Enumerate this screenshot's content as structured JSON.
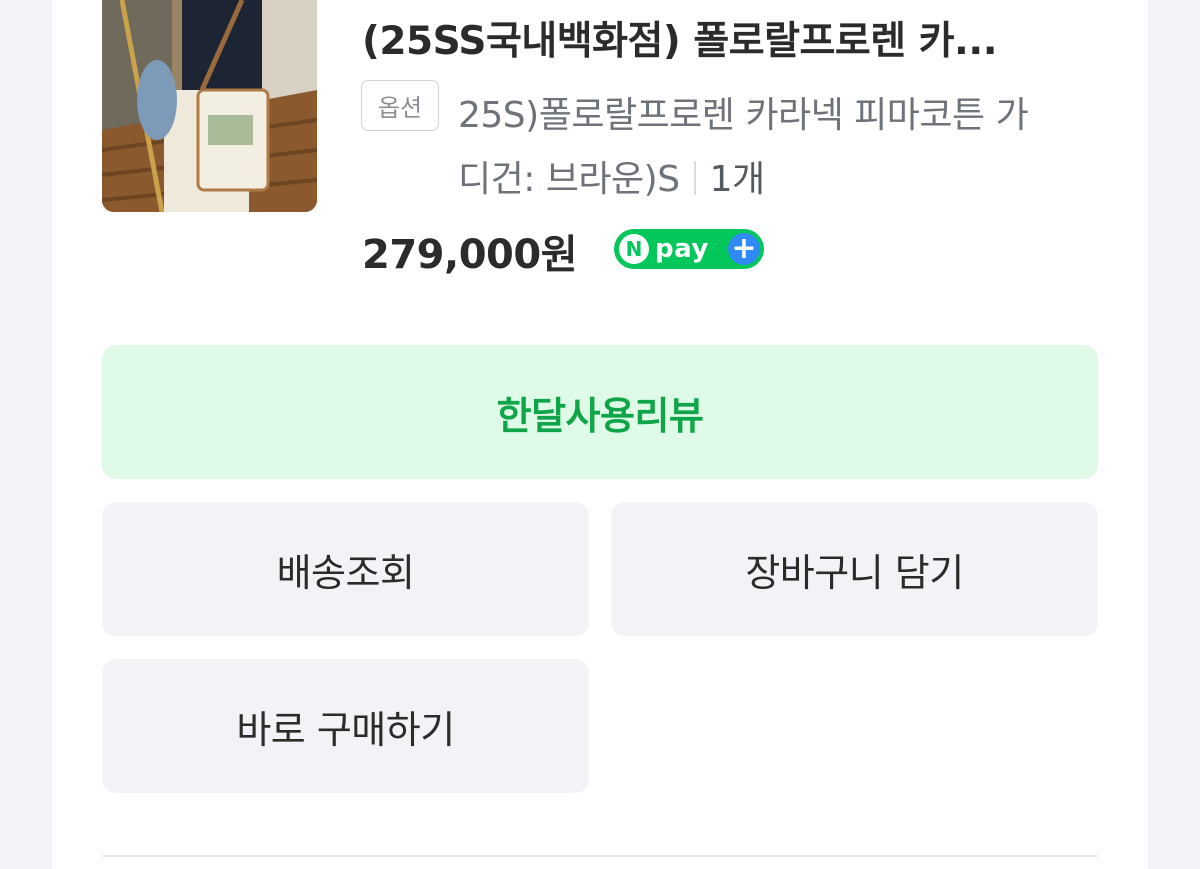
{
  "product": {
    "title": "(25SS국내백화점) 폴로랄프로렌 카...",
    "option_badge": "옵션",
    "option_line1": "25S)폴로랄프로렌 카라넥 피마코튼 가",
    "option_line2": "디건: 브라운)S",
    "quantity": "1개",
    "price": "279,000원",
    "npay_n": "N",
    "npay_text": "pay",
    "npay_plus": "+"
  },
  "actions": {
    "review": "한달사용리뷰",
    "track_delivery": "배송조회",
    "add_to_cart": "장바구니 담기",
    "buy_now": "바로 구매하기"
  },
  "colors": {
    "review_bg": "#dffbe8",
    "review_text": "#0fa548",
    "npay_green": "#03c75a",
    "npay_plus_blue": "#2f8af5",
    "button_gray": "#f1f3f6"
  }
}
